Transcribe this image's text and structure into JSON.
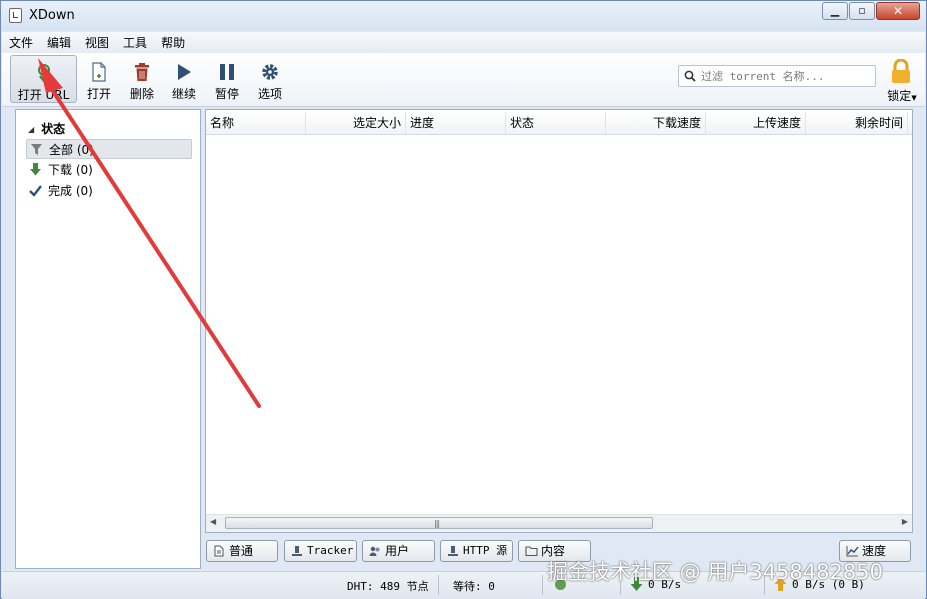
{
  "window": {
    "title": "XDown"
  },
  "colors": {
    "accent": "#3a6ea5",
    "download_green": "#3f8a3a",
    "delete_red": "#a03a2a",
    "arrow_red": "#e33b3b"
  },
  "menu": [
    "文件",
    "编辑",
    "视图",
    "工具",
    "帮助"
  ],
  "toolbar": {
    "open_url_label": "打开 URL",
    "open_label": "打开",
    "delete_label": "删除",
    "resume_label": "继续",
    "pause_label": "暂停",
    "options_label": "选项",
    "lock_label": "锁定",
    "search_placeholder": "过滤 torrent 名称..."
  },
  "sidebar": {
    "heading": "状态",
    "items": [
      {
        "label": "全部 (0)",
        "icon": "filter-icon"
      },
      {
        "label": "下载 (0)",
        "icon": "arrow-down-icon"
      },
      {
        "label": "完成 (0)",
        "icon": "checkmark-icon"
      }
    ]
  },
  "table": {
    "columns": [
      "名称",
      "选定大小",
      "进度",
      "状态",
      "下载速度",
      "上传速度",
      "剩余时间"
    ]
  },
  "bottom_tabs": {
    "general": "普通",
    "tracker": "Tracker",
    "peers": "用户",
    "http_sources": "HTTP 源",
    "content": "内容",
    "speed": "速度"
  },
  "status": {
    "dht": "DHT: 489 节点",
    "waiting": "等待: 0",
    "download_speed": "0 B/s",
    "upload_speed": "0 B/s (0 B)"
  },
  "watermark": "掘金技术社区 @ 用户3458482850"
}
